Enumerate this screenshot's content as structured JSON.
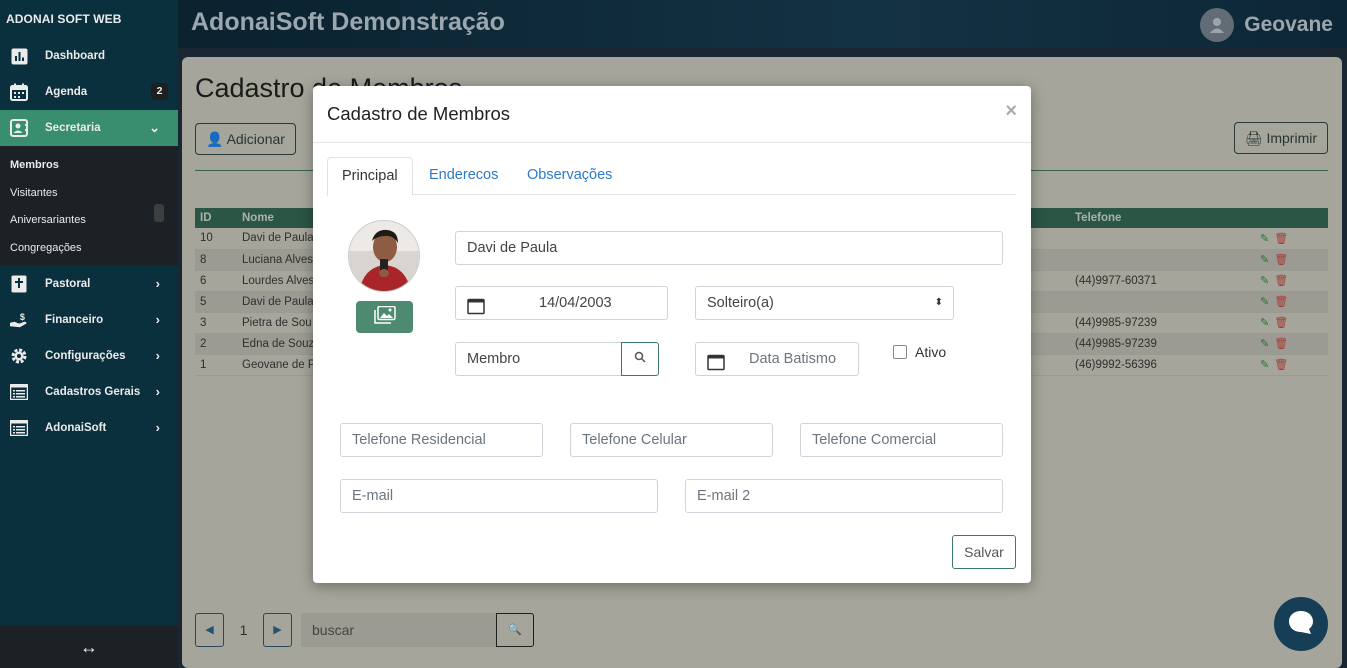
{
  "sidebar": {
    "brand": "ADONAI SOFT WEB",
    "items": [
      {
        "label": "Dashboard",
        "icon": "chart-icon"
      },
      {
        "label": "Agenda",
        "icon": "calendar-icon",
        "badge": "2"
      },
      {
        "label": "Secretaria",
        "icon": "contact-card-icon"
      },
      {
        "label": "Pastoral",
        "icon": "bible-icon"
      },
      {
        "label": "Financeiro",
        "icon": "hand-money-icon"
      },
      {
        "label": "Configurações",
        "icon": "gear-icon"
      },
      {
        "label": "Cadastros Gerais",
        "icon": "list-icon"
      },
      {
        "label": "AdonaiSoft",
        "icon": "list-icon"
      }
    ],
    "subitems": [
      "Membros",
      "Visitantes",
      "Aniversariantes",
      "Congregações"
    ],
    "footer_icon": "↔"
  },
  "topbar": {
    "title": "AdonaiSoft Demonstração",
    "user": "Geovane"
  },
  "page": {
    "title": "Cadastro de Membros",
    "add_button": "Adicionar",
    "print_button": "Imprimir",
    "table": {
      "headers": [
        "ID",
        "Nome",
        "Telefone"
      ],
      "rows": [
        {
          "id": "10",
          "nome": "Davi de Paula",
          "tel": ""
        },
        {
          "id": "8",
          "nome": "Luciana Alves",
          "tel": ""
        },
        {
          "id": "6",
          "nome": "Lourdes Alves",
          "tel": "(44)9977-60371"
        },
        {
          "id": "5",
          "nome": "Davi de Paula",
          "tel": ""
        },
        {
          "id": "3",
          "nome": "Pietra de Sou",
          "tel": "(44)9985-97239"
        },
        {
          "id": "2",
          "nome": "Edna de Souz",
          "tel": "(44)9985-97239"
        },
        {
          "id": "1",
          "nome": "Geovane de P",
          "tel": "(46)9992-56396"
        }
      ]
    },
    "pager": {
      "page": "1"
    },
    "search_placeholder": "buscar"
  },
  "modal": {
    "title": "Cadastro de Membros",
    "close": "×",
    "tabs": [
      "Principal",
      "Enderecos",
      "Observações"
    ],
    "name": "Davi de Paula",
    "birth_date": "14/04/2003",
    "marital_status": "Solteiro(a)",
    "member_type": "Membro",
    "baptism_placeholder": "Data Batismo",
    "active_label": "Ativo",
    "phone_res_placeholder": "Telefone Residencial",
    "phone_cel_placeholder": "Telefone Celular",
    "phone_com_placeholder": "Telefone Comercial",
    "email_placeholder": "E-mail",
    "email2_placeholder": "E-mail 2",
    "save_button": "Salvar"
  },
  "colors": {
    "sidebar_bg": "#0b3343",
    "active_green": "#3e9b79",
    "link_blue": "#2a7ac8"
  }
}
